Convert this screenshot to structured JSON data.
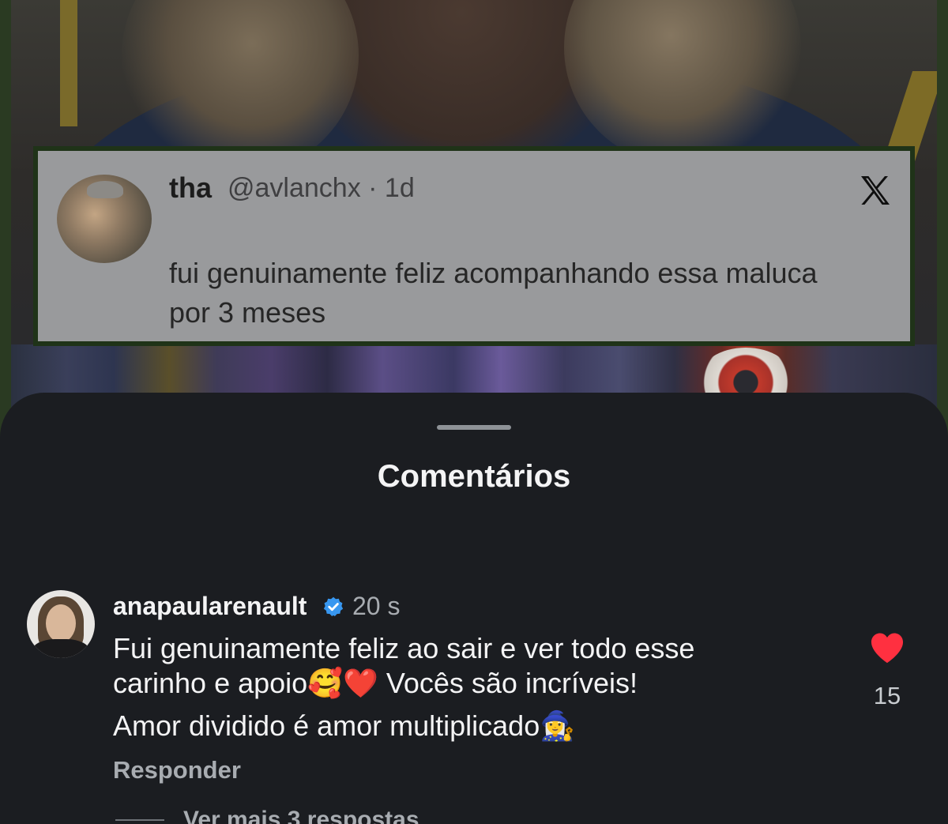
{
  "tweet": {
    "name": "tha",
    "handle": "@avlanchx · 1d",
    "text": "fui genuinamente feliz acompanhando essa maluca por 3 meses",
    "platform_icon": "x-logo-icon"
  },
  "sheet": {
    "title": "Comentários"
  },
  "comment": {
    "username": "anapaularenault",
    "verified_icon": "verified-badge-icon",
    "time": "20 s",
    "text_line1": "Fui genuinamente feliz ao sair e ver todo esse",
    "text_line2": "carinho e apoio🥰❤️  Vocês são incríveis!",
    "text_line3": "Amor dividido é amor multiplicado🧙‍♀️",
    "reply_label": "Responder",
    "like_count": "15",
    "like_icon": "heart-icon",
    "more_replies": "Ver mais 3 respostas"
  },
  "colors": {
    "sheet_bg": "#1b1d21",
    "like_red": "#ff3040",
    "verified_blue": "#3897f0",
    "tweet_border": "#1f3318"
  }
}
